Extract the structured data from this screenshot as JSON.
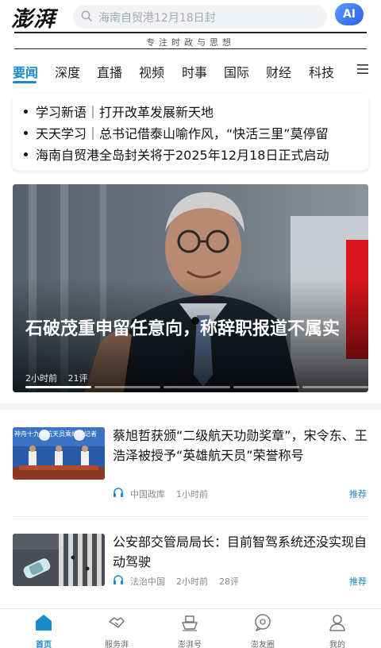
{
  "header": {
    "logo": "澎湃",
    "search_placeholder": "海南自贸港12月18日封",
    "ai_label": "AI",
    "slogan": "专注时政与思想"
  },
  "tabs": [
    {
      "label": "要闻",
      "active": true
    },
    {
      "label": "深度"
    },
    {
      "label": "直播"
    },
    {
      "label": "视频"
    },
    {
      "label": "时事"
    },
    {
      "label": "国际"
    },
    {
      "label": "财经"
    },
    {
      "label": "科技"
    }
  ],
  "bulletin": [
    "学习新语｜打开改革发展新天地",
    "天天学习｜总书记借泰山喻作风，“快活三里”莫停留",
    "海南自贸港全岛封关将于2025年12月18日正式启动"
  ],
  "hero": {
    "title": "石破茂重申留任意向，称辞职报道不属实",
    "time": "2小时前",
    "comments": "21评",
    "slides": 5,
    "active_slide": 0
  },
  "news": [
    {
      "title": "蔡旭哲获颁“二级航天功勋奖章”，宋令东、王浩泽被授予“英雄航天员”荣誉称号",
      "source": "中国政库",
      "time": "1小时前",
      "comments": "",
      "tag": "推荐",
      "thumb_caption": "神舟十九号航天员乘组与记者",
      "thumb": "ceremony"
    },
    {
      "title": "公安部交管局局长：目前智驾系统还没实现自动驾驶",
      "source": "法治中国",
      "time": "2小时前",
      "comments": "28评",
      "tag": "推荐",
      "thumb": "crosswalk"
    }
  ],
  "bottom_nav": [
    {
      "label": "首页",
      "icon": "home-icon",
      "active": true
    },
    {
      "label": "服务湃",
      "icon": "handshake-icon"
    },
    {
      "label": "澎湃号",
      "icon": "ship-icon"
    },
    {
      "label": "澎友圈",
      "icon": "chat-bubble-icon"
    },
    {
      "label": "我的",
      "icon": "person-icon"
    }
  ],
  "colors": {
    "accent": "#1a8acb",
    "ai_gradient_start": "#5a9bff",
    "ai_gradient_end": "#2e5fe6"
  }
}
